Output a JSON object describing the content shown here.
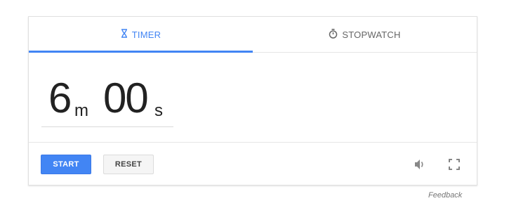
{
  "tabs": {
    "timer_label": "TIMER",
    "stopwatch_label": "STOPWATCH",
    "timer_icon": "hourglass-icon",
    "stopwatch_icon": "stopwatch-icon",
    "active": "timer"
  },
  "display": {
    "minutes": "6",
    "minutes_unit": "m",
    "seconds": "00",
    "seconds_unit": "s"
  },
  "controls": {
    "start_label": "START",
    "reset_label": "RESET",
    "volume_icon": "volume-icon",
    "fullscreen_icon": "fullscreen-icon"
  },
  "footer": {
    "feedback_label": "Feedback"
  },
  "colors": {
    "accent": "#4285f4",
    "text": "#222222"
  }
}
